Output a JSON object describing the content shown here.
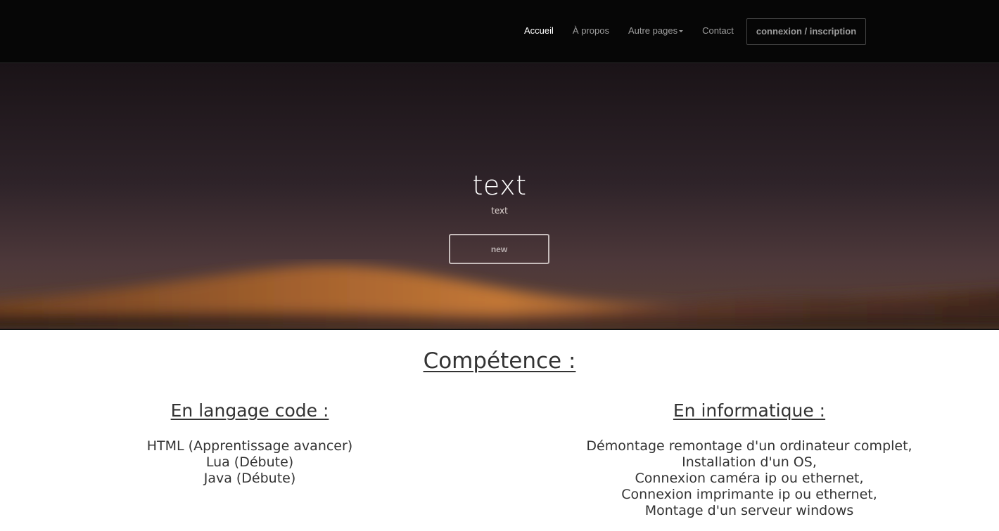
{
  "navbar": {
    "links": [
      {
        "label": "Accueil",
        "active": true
      },
      {
        "label": "À propos",
        "active": false
      },
      {
        "label": "Autre pages",
        "active": false
      },
      {
        "label": "Contact",
        "active": false
      }
    ],
    "login_button": "connexion / inscription"
  },
  "hero": {
    "title": "text",
    "subtitle": "text",
    "button": "new"
  },
  "skills": {
    "title": "Compétence :",
    "code": {
      "heading": "En langage code :",
      "items": [
        "HTML (Apprentissage avancer)",
        "Lua (Débute)",
        "Java (Débute)"
      ]
    },
    "informatique": {
      "heading": "En informatique :",
      "items": [
        "Démontage remontage d'un ordinateur complet,",
        "Installation d'un OS,",
        "Connexion caméra ip ou ethernet,",
        "Connexion imprimante ip ou ethernet,",
        "Montage d'un serveur windows"
      ]
    }
  },
  "colors": {
    "navbar_bg": "#060606",
    "nav_text": "#9d9d9d",
    "nav_active": "#ffffff",
    "body_text": "#333333",
    "dune_orange": "#c87a3a"
  }
}
